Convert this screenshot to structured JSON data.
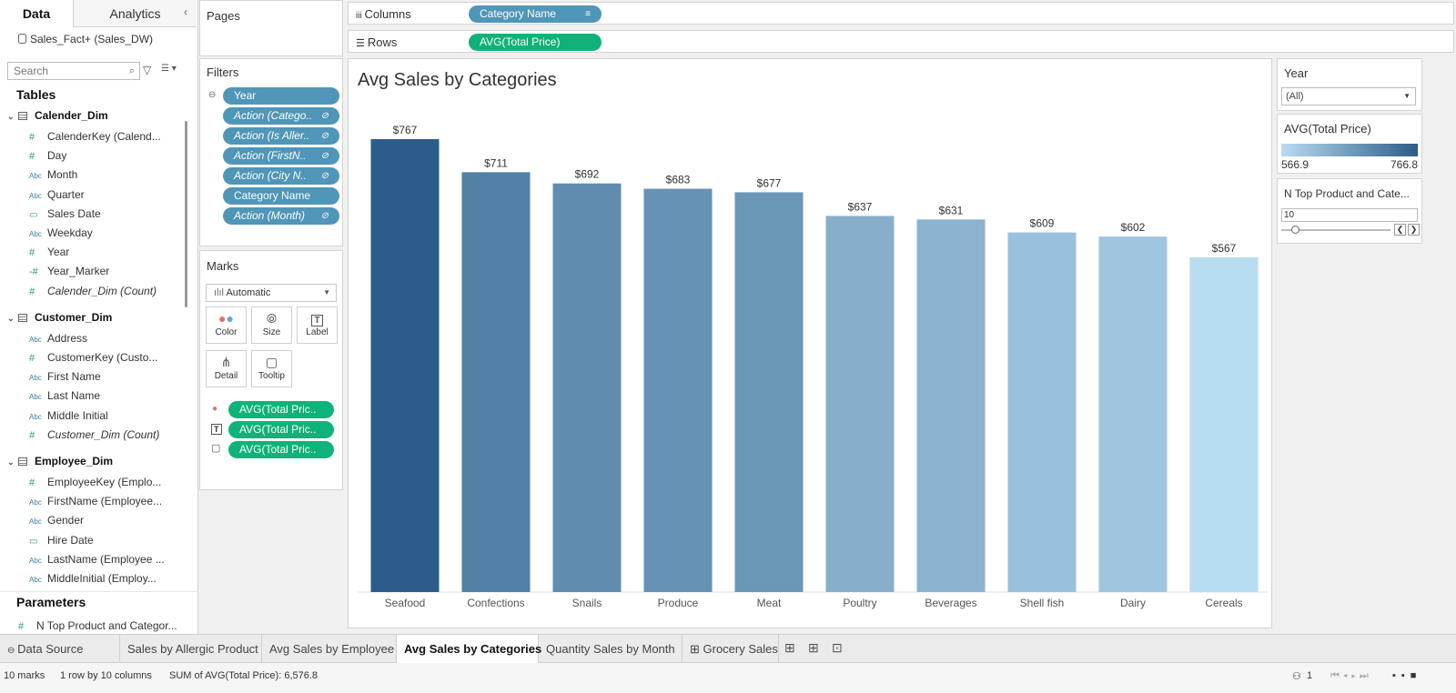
{
  "left_pane": {
    "tabs": [
      "Data",
      "Analytics"
    ],
    "datasource": "Sales_Fact+ (Sales_DW)",
    "search_placeholder": "Search",
    "tables_header": "Tables",
    "parameters_header": "Parameters",
    "parameter_item": "N Top Product and Categor..."
  },
  "tree": [
    {
      "type": "group",
      "label": "Calender_Dim"
    },
    {
      "type": "field",
      "icon": "#",
      "kind": "num",
      "label": "CalenderKey (Calend..."
    },
    {
      "type": "field",
      "icon": "#",
      "kind": "num",
      "label": "Day"
    },
    {
      "type": "field",
      "icon": "Abc",
      "kind": "str",
      "label": "Month"
    },
    {
      "type": "field",
      "icon": "Abc",
      "kind": "str",
      "label": "Quarter"
    },
    {
      "type": "field",
      "icon": "▭",
      "kind": "date",
      "label": "Sales Date"
    },
    {
      "type": "field",
      "icon": "Abc",
      "kind": "str",
      "label": "Weekday"
    },
    {
      "type": "field",
      "icon": "#",
      "kind": "num",
      "label": "Year"
    },
    {
      "type": "field",
      "icon": "-#",
      "kind": "num",
      "label": "Year_Marker"
    },
    {
      "type": "count",
      "icon": "#",
      "kind": "num",
      "label": "Calender_Dim (Count)"
    },
    {
      "type": "group",
      "label": "Customer_Dim"
    },
    {
      "type": "field",
      "icon": "Abc",
      "kind": "str",
      "label": "Address"
    },
    {
      "type": "field",
      "icon": "#",
      "kind": "num",
      "label": "CustomerKey (Custo..."
    },
    {
      "type": "field",
      "icon": "Abc",
      "kind": "str",
      "label": "First Name"
    },
    {
      "type": "field",
      "icon": "Abc",
      "kind": "str",
      "label": "Last Name"
    },
    {
      "type": "field",
      "icon": "Abc",
      "kind": "str",
      "label": "Middle Initial"
    },
    {
      "type": "count",
      "icon": "#",
      "kind": "num",
      "label": "Customer_Dim (Count)"
    },
    {
      "type": "group",
      "label": "Employee_Dim"
    },
    {
      "type": "field",
      "icon": "#",
      "kind": "num",
      "label": "EmployeeKey (Emplo..."
    },
    {
      "type": "field",
      "icon": "Abc",
      "kind": "str",
      "label": "FirstName (Employee..."
    },
    {
      "type": "field",
      "icon": "Abc",
      "kind": "str",
      "label": "Gender"
    },
    {
      "type": "field",
      "icon": "▭",
      "kind": "date",
      "label": "Hire Date"
    },
    {
      "type": "field",
      "icon": "Abc",
      "kind": "str",
      "label": "LastName (Employee ..."
    },
    {
      "type": "field",
      "icon": "Abc",
      "kind": "str",
      "label": "MiddleInitial (Employ..."
    }
  ],
  "pages": {
    "title": "Pages"
  },
  "filters": {
    "title": "Filters",
    "pills": [
      {
        "label": "Year",
        "italic": false,
        "link": false
      },
      {
        "label": "Action (Catego..",
        "italic": true,
        "link": true
      },
      {
        "label": "Action (Is Aller..",
        "italic": true,
        "link": true
      },
      {
        "label": "Action (FirstN..",
        "italic": true,
        "link": true
      },
      {
        "label": "Action (City N..",
        "italic": true,
        "link": true
      },
      {
        "label": "Category Name",
        "italic": false,
        "link": false
      },
      {
        "label": "Action (Month)",
        "italic": true,
        "link": true
      }
    ]
  },
  "marks": {
    "title": "Marks",
    "type": "Automatic",
    "buttons": [
      "Color",
      "Size",
      "Label",
      "Detail",
      "Tooltip"
    ],
    "pills": [
      "AVG(Total Pric..",
      "AVG(Total Pric..",
      "AVG(Total Pric.."
    ]
  },
  "shelves": {
    "columns_label": "Columns",
    "columns_pill": "Category Name",
    "rows_label": "Rows",
    "rows_pill": "AVG(Total Price)"
  },
  "chart_data": {
    "type": "bar",
    "title": "Avg Sales by Categories",
    "categories": [
      "Seafood",
      "Confections",
      "Snails",
      "Produce",
      "Meat",
      "Poultry",
      "Beverages",
      "Shell fish",
      "Dairy",
      "Cereals"
    ],
    "values": [
      767,
      711,
      692,
      683,
      677,
      637,
      631,
      609,
      602,
      567
    ],
    "labels": [
      "$767",
      "$711",
      "$692",
      "$683",
      "$677",
      "$637",
      "$631",
      "$609",
      "$602",
      "$567"
    ],
    "color_range": [
      566.9,
      766.8
    ],
    "colors": {
      "low": "#b8dcf0",
      "high": "#2b5c8a"
    }
  },
  "right_pane": {
    "year_title": "Year",
    "year_value": "(All)",
    "legend_title": "AVG(Total Price)",
    "legend_min": "566.9",
    "legend_max": "766.8",
    "param_title": "N Top Product and Cate...",
    "param_value": "10"
  },
  "bottom_tabs": [
    {
      "label": "Data Source",
      "active": false
    },
    {
      "label": "Sales by Allergic Product",
      "active": false
    },
    {
      "label": "Avg Sales by Employee",
      "active": false
    },
    {
      "label": "Avg Sales by Categories",
      "active": true
    },
    {
      "label": "Quantity Sales by Month",
      "active": false
    },
    {
      "label": "Grocery Sales",
      "active": false
    }
  ],
  "status": {
    "marks": "10 marks",
    "rows_cols": "1 row by 10 columns",
    "sum": "SUM of AVG(Total Price): 6,576.8",
    "user_count": "1"
  }
}
